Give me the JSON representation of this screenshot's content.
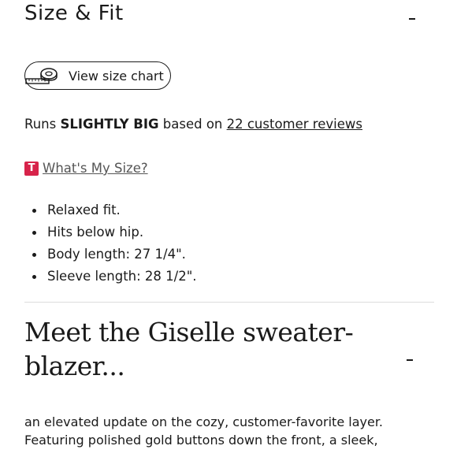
{
  "size_fit": {
    "title": "Size & Fit",
    "collapse_icon": "minus-icon",
    "size_chart_button": {
      "label": "View size chart",
      "icon": "tape-measure-icon"
    },
    "fit": {
      "prefix": "Runs ",
      "rating": "SLIGHTLY BIG",
      "middle": " based on ",
      "reviews_link": "22 customer reviews"
    },
    "whats_my_size": {
      "badge": "T",
      "link": "What's My Size?",
      "badge_color": "#d7234a"
    },
    "features": [
      "Relaxed fit.",
      "Hits below hip.",
      "Body length: 27 1/4\".",
      "Sleeve length: 28 1/2\"."
    ]
  },
  "promo": {
    "title": "Meet the Giselle sweater-blazer...",
    "collapse_icon": "minus-icon",
    "body_lines": [
      "an elevated update on the cozy, customer-favorite layer.",
      "Featuring polished gold buttons down the front, a sleek,"
    ]
  }
}
